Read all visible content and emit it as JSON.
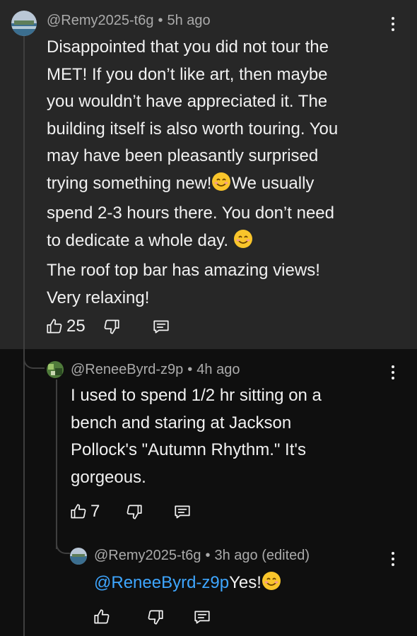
{
  "comment": {
    "author": "@Remy2025-t6g",
    "time": "5h ago",
    "lines": [
      "Disappointed that you did not tour the",
      "MET! If you don’t like art, then maybe",
      "you wouldn’t have appreciated it. The",
      "building itself is also worth touring. You",
      "may have been pleasantly surprised",
      "trying something new!",
      "We usually",
      "spend 2-3 hours there. You don’t need",
      "to dedicate a whole day. ",
      "The roof top bar has amazing views!",
      "Very relaxing!"
    ],
    "likes": "25"
  },
  "reply1": {
    "author": "@ReneeByrd-z9p",
    "time": "4h ago",
    "lines": [
      "I used to spend 1/2 hr sitting on a",
      "bench and staring at Jackson",
      "Pollock's \"Autumn Rhythm.\" It's",
      "gorgeous."
    ],
    "likes": "7"
  },
  "reply2": {
    "author": "@Remy2025-t6g",
    "time": "3h ago (edited)",
    "mention": "@ReneeByrd-z9p",
    "text": "Yes!"
  },
  "icons": {
    "like": "thumbs-up-icon",
    "dislike": "thumbs-down-icon",
    "reply": "reply-icon",
    "more": "more-vert-icon",
    "emoji": "smiling-face-emoji"
  },
  "colors": {
    "background": "#0f0f0f",
    "highlight": "#272727",
    "mention": "#3ea6ff",
    "meta": "#aaaaaa"
  }
}
